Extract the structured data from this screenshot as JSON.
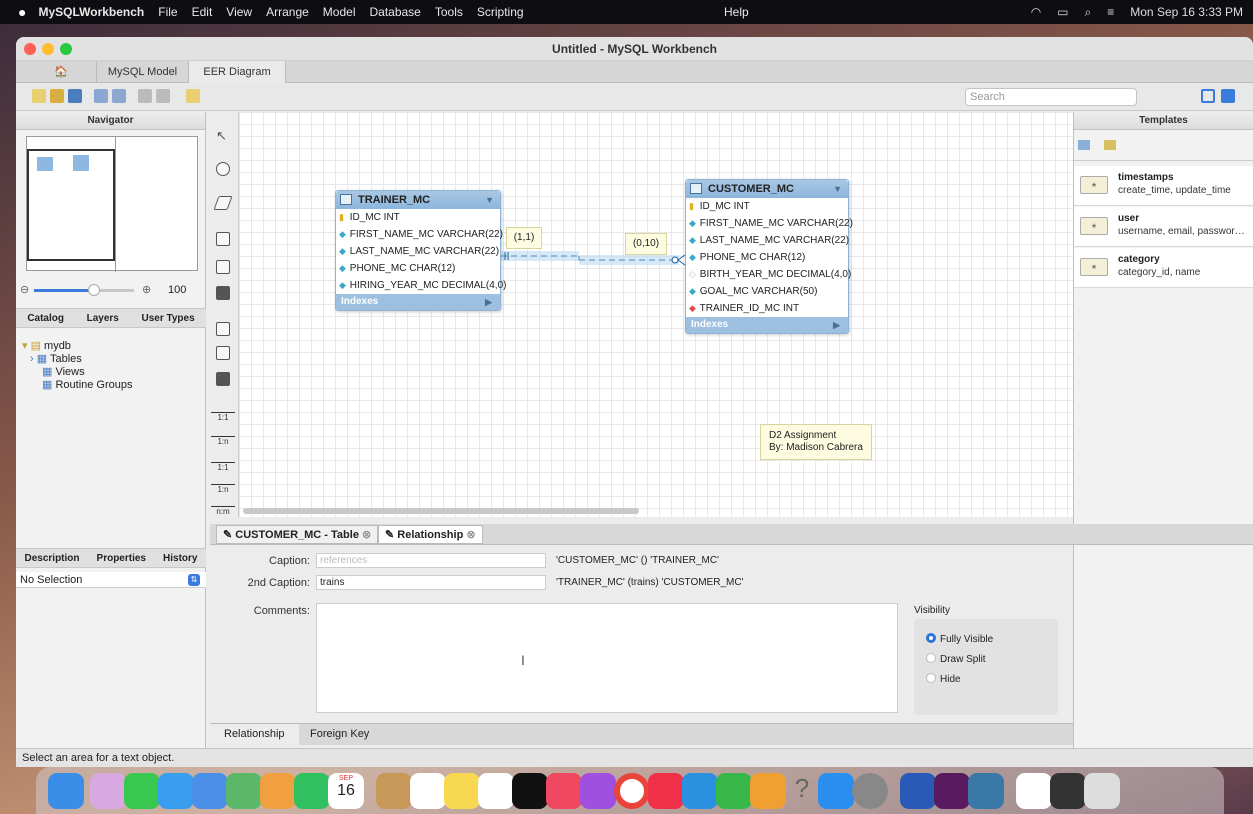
{
  "menubar": {
    "apple": "",
    "app": "MySQLWorkbench",
    "items": [
      "File",
      "Edit",
      "View",
      "Arrange",
      "Model",
      "Database",
      "Tools",
      "Scripting",
      "Help"
    ],
    "datetime": "Mon Sep 16 3:33 PM"
  },
  "window": {
    "title": "Untitled - MySQL Workbench"
  },
  "tabs": {
    "home": "🏠",
    "model": "MySQL Model",
    "eer": "EER Diagram"
  },
  "search": {
    "placeholder": "Search"
  },
  "navigator": {
    "title": "Navigator",
    "zoom": "100",
    "subtabs": [
      "Catalog",
      "Layers",
      "User Types"
    ],
    "tree": {
      "schema": "mydb",
      "tables": "Tables",
      "views": "Views",
      "routines": "Routine Groups"
    }
  },
  "desc": {
    "tabs": [
      "Description",
      "Properties",
      "History"
    ],
    "selection": "No Selection"
  },
  "palette": {
    "t1": "1:1",
    "t2": "1:n",
    "t3": "1:1",
    "t4": "1:n",
    "t5": "n:m"
  },
  "trainer": {
    "name": "TRAINER_MC",
    "columns": [
      {
        "key": "pk",
        "text": "ID_MC INT"
      },
      {
        "key": "col",
        "text": "FIRST_NAME_MC VARCHAR(22)"
      },
      {
        "key": "col",
        "text": "LAST_NAME_MC VARCHAR(22)"
      },
      {
        "key": "col",
        "text": "PHONE_MC CHAR(12)"
      },
      {
        "key": "col",
        "text": "HIRING_YEAR_MC DECIMAL(4,0)"
      }
    ],
    "indexes": "Indexes"
  },
  "customer": {
    "name": "CUSTOMER_MC",
    "columns": [
      {
        "key": "pk",
        "text": "ID_MC INT"
      },
      {
        "key": "col",
        "text": "FIRST_NAME_MC VARCHAR(22)"
      },
      {
        "key": "col",
        "text": "LAST_NAME_MC VARCHAR(22)"
      },
      {
        "key": "col",
        "text": "PHONE_MC CHAR(12)"
      },
      {
        "key": "nullable",
        "text": "BIRTH_YEAR_MC DECIMAL(4,0)"
      },
      {
        "key": "col",
        "text": "GOAL_MC VARCHAR(50)"
      },
      {
        "key": "fk",
        "text": "TRAINER_ID_MC INT"
      }
    ],
    "indexes": "Indexes"
  },
  "relationship": {
    "card_left": "(1,1)",
    "card_right": "(0,10)"
  },
  "note": {
    "line1": "D2 Assignment",
    "line2": "By: Madison Cabrera"
  },
  "templates": {
    "title": "Templates",
    "items": [
      {
        "name": "timestamps",
        "desc": "create_time, update_time"
      },
      {
        "name": "user",
        "desc": "username, email, password, cr..."
      },
      {
        "name": "category",
        "desc": "category_id, name"
      }
    ]
  },
  "editor": {
    "tab1": "CUSTOMER_MC - Table",
    "tab2": "Relationship",
    "caption_label": "Caption:",
    "caption_placeholder": "references",
    "caption_desc": "'CUSTOMER_MC' () 'TRAINER_MC'",
    "caption2_label": "2nd Caption:",
    "caption2_value": "trains",
    "caption2_desc": "'TRAINER_MC' (trains) 'CUSTOMER_MC'",
    "comments_label": "Comments:",
    "visibility_title": "Visibility",
    "vis_options": [
      "Fully Visible",
      "Draw Split",
      "Hide"
    ],
    "bottom_tabs": [
      "Relationship",
      "Foreign Key"
    ]
  },
  "status": {
    "text": "Select an area for a text object."
  },
  "dock": {
    "calendar_month": "SEP",
    "calendar_day": "16"
  }
}
